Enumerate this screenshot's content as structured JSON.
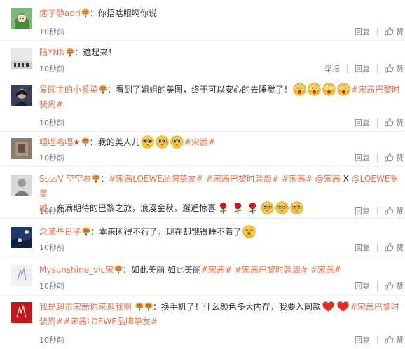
{
  "labels": {
    "reply": "回复",
    "like": "赞",
    "report": "举报"
  },
  "comments": [
    {
      "username": "痞子静aori",
      "text": "：你捂啥眼啊你说",
      "time": "10秒前"
    },
    {
      "username": "陆YNN",
      "text": "：遮起来！",
      "time": "10秒前"
    },
    {
      "username": "爱园主的小番菜",
      "text": "：看到了姐姐的美图，终于可以安心的去睡觉了！",
      "tag1": "#宋茜巴黎时",
      "tag2": "装周#",
      "time": "10秒前"
    },
    {
      "username": "嘎哩咯嘎",
      "text": "：我的美人儿",
      "tag1": "#宋茜#",
      "time": "10秒前"
    },
    {
      "username": "SsssV-空空君",
      "text1": "：",
      "tag1": "#宋茜LOEWE品牌挚友#",
      "tag2": "#宋茜巴黎时装周#",
      "tag3": "#宋茜#",
      "mention1": "@宋茜",
      "x": " X ",
      "mention2": "@LOEWE罗意",
      "mention3": "威",
      "text2": "，充满期待的巴黎之旅，浪漫金秋，邂逅惊喜",
      "time": "10秒前"
    },
    {
      "username": "念某些日子",
      "text": "：本来困得不行了，现在却饿得睡不着了",
      "time": "10秒前"
    },
    {
      "username": "Mysunshine_vic宋",
      "text1": "：如此美丽 如此美丽",
      "tag1": "#宋茜#",
      "tag2": "#宋茜巴黎时装周#",
      "tag3": "#宋茜#",
      "time": "10秒前"
    },
    {
      "username": "我是超市宋茜你来逛我啊",
      "text": "：换手机了！什么颜色多大内存，我要入同款",
      "tag1": "#宋茜巴黎时",
      "tag2": "装周#",
      "tag3": "#宋茜LOEWE品牌挚友#",
      "time": "10秒前"
    }
  ]
}
